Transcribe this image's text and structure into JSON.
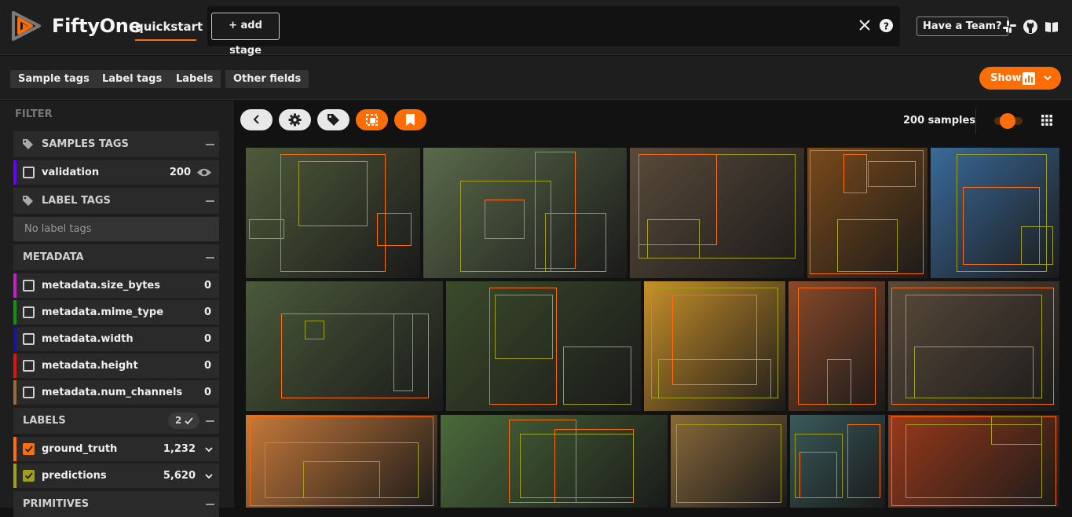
{
  "header": {
    "brand": "FiftyOne",
    "dataset": "quickstart",
    "add_stage": "+ add stage",
    "team_button": "Have a Team?",
    "icons": [
      "close-icon",
      "help-icon",
      "slack-icon",
      "github-icon",
      "docs-icon"
    ]
  },
  "subbar": {
    "chips": [
      "Sample tags",
      "Label tags",
      "Labels",
      "Other fields"
    ],
    "show_button": "Show"
  },
  "sidebar": {
    "filter_title": "FILTER",
    "samples_tags": {
      "title": "SAMPLES TAGS",
      "items": [
        {
          "name": "validation",
          "count": "200",
          "color": "#6a00ff"
        }
      ]
    },
    "label_tags": {
      "title": "LABEL TAGS",
      "empty": "No label tags"
    },
    "metadata": {
      "title": "METADATA",
      "items": [
        {
          "name": "metadata.size_bytes",
          "count": "0",
          "color": "#c41ec4"
        },
        {
          "name": "metadata.mime_type",
          "count": "0",
          "color": "#109310"
        },
        {
          "name": "metadata.width",
          "count": "0",
          "color": "#1515a4"
        },
        {
          "name": "metadata.height",
          "count": "0",
          "color": "#e01212"
        },
        {
          "name": "metadata.num_channels",
          "count": "0",
          "color": "#9a6a3a"
        }
      ]
    },
    "labels": {
      "title": "LABELS",
      "badge": "2",
      "items": [
        {
          "name": "ground_truth",
          "count": "1,232",
          "color": "#ff6d04"
        },
        {
          "name": "predictions",
          "count": "5,620",
          "color": "#a0a017"
        }
      ]
    },
    "primitives": {
      "title": "PRIMITIVES"
    }
  },
  "grid": {
    "sample_count": "200 samples",
    "accent": "#ff6d04",
    "tiles": [
      {
        "name": "tile-bird",
        "bg": "#4f5a3a"
      },
      {
        "name": "tile-horse-rider",
        "bg": "#5a6a4a"
      },
      {
        "name": "tile-cats",
        "bg": "#5a4a3a"
      },
      {
        "name": "tile-food-table",
        "bg": "#7a4a1a"
      },
      {
        "name": "tile-cake",
        "bg": "#3a6a9a"
      },
      {
        "name": "tile-train",
        "bg": "#4a5a3a"
      },
      {
        "name": "tile-cow",
        "bg": "#3a4a2a"
      },
      {
        "name": "tile-cat-bowl",
        "bg": "#c8902a"
      },
      {
        "name": "tile-man-tie",
        "bg": "#8a4a2a"
      },
      {
        "name": "tile-cat-sleeping",
        "bg": "#5a4a3a"
      },
      {
        "name": "tile-cake-slice",
        "bg": "#c87a3a"
      },
      {
        "name": "tile-dogs",
        "bg": "#4a6a3a"
      },
      {
        "name": "tile-bear",
        "bg": "#8a6a3a"
      },
      {
        "name": "tile-toy",
        "bg": "#3a5a5a"
      },
      {
        "name": "tile-pizza",
        "bg": "#9a3a1a"
      }
    ]
  }
}
